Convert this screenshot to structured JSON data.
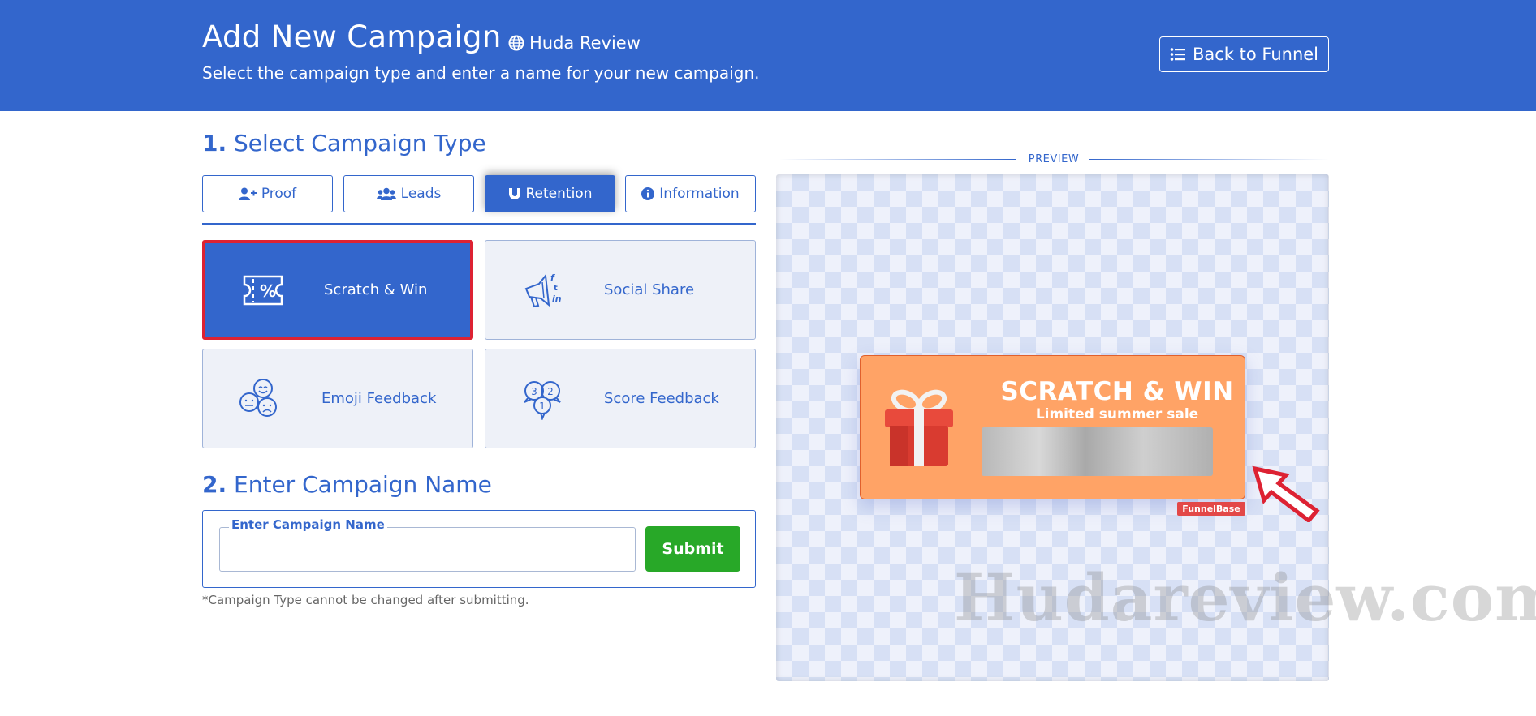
{
  "header": {
    "title": "Add New Campaign",
    "site": "Huda Review",
    "subtitle": "Select the campaign type and enter a name for your new campaign.",
    "back_label": "Back to Funnel"
  },
  "section1": {
    "number": "1.",
    "title": "Select Campaign Type"
  },
  "tabs": [
    {
      "label": "Proof",
      "icon": "user-plus-icon",
      "active": false
    },
    {
      "label": "Leads",
      "icon": "users-icon",
      "active": false
    },
    {
      "label": "Retention",
      "icon": "magnet-icon",
      "active": true
    },
    {
      "label": "Information",
      "icon": "info-circle-icon",
      "active": false
    }
  ],
  "types": [
    {
      "label": "Scratch & Win",
      "icon": "scratch-ticket-icon",
      "selected": true
    },
    {
      "label": "Social Share",
      "icon": "megaphone-social-icon",
      "selected": false
    },
    {
      "label": "Emoji Feedback",
      "icon": "emoji-faces-icon",
      "selected": false
    },
    {
      "label": "Score Feedback",
      "icon": "score-bubbles-icon",
      "selected": false
    }
  ],
  "section2": {
    "number": "2.",
    "title": "Enter Campaign Name"
  },
  "form": {
    "field_label": "Enter Campaign Name",
    "field_value": "",
    "submit_label": "Submit",
    "note": "*Campaign Type cannot be changed after submitting."
  },
  "preview": {
    "label": "PREVIEW",
    "promo_title": "SCRATCH & WIN",
    "promo_subtitle": "Limited summer sale",
    "badge": "FunnelBase",
    "watermark": "Hudareview.com"
  },
  "colors": {
    "primary": "#3366cc",
    "submit": "#28a828",
    "selected_border": "#dd2233",
    "promo": "#ffa366",
    "arrow": "#dd2233"
  }
}
